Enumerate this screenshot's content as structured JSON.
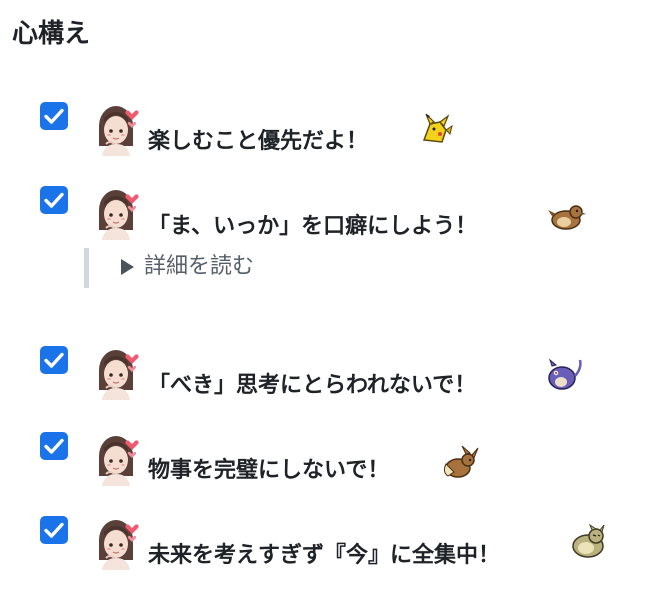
{
  "heading": "心構え",
  "tasks": [
    {
      "text": "楽しむこと優先だよ！",
      "checked": true,
      "sprite_icon": "pikachu-icon"
    },
    {
      "text": "「ま、いっか」を口癖にしよう！",
      "checked": true,
      "sprite_icon": "pidgey-icon"
    },
    {
      "text": "「べき」思考にとらわれないで！",
      "checked": true,
      "sprite_icon": "rattata-icon"
    },
    {
      "text": "物事を完璧にしないで！",
      "checked": true,
      "sprite_icon": "eevee-icon"
    },
    {
      "text": "未来を考えすぎず『今』に全集中！",
      "checked": true,
      "sprite_icon": "snorlax-icon"
    }
  ],
  "details": {
    "summary": "詳細を読む",
    "open": false
  },
  "colors": {
    "checkbox": "#1a73e8",
    "text": "#1f2328",
    "details_border": "#d0d7de",
    "summary_text": "#57606a"
  }
}
